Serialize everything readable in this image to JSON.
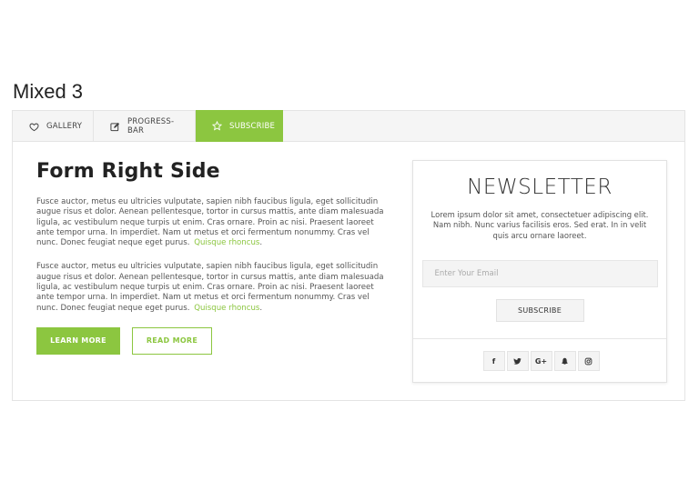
{
  "page": {
    "title": "Mixed 3"
  },
  "tabs": [
    {
      "label": "GALLERY",
      "icon": "heart-icon"
    },
    {
      "label": "PROGRESS-BAR",
      "icon": "edit-icon"
    },
    {
      "label": "SUBSCRIBE",
      "icon": "star-icon",
      "active": true
    }
  ],
  "content": {
    "heading": "Form Right Side",
    "paragraphs": [
      {
        "text": "Fusce auctor, metus eu ultricies vulputate, sapien nibh faucibus ligula, eget sollicitudin augue risus et dolor. Aenean pellentesque, tortor in cursus mattis, ante diam malesuada ligula, ac vestibulum neque turpis ut enim. Cras ornare. Proin ac nisi. Praesent laoreet ante tempor urna. In imperdiet. Nam ut metus et orci fermentum nonummy. Cras vel nunc. Donec feugiat neque eget purus.",
        "link": "Quisque rhoncus",
        "suffix": "."
      },
      {
        "text": "Fusce auctor, metus eu ultricies vulputate, sapien nibh faucibus ligula, eget sollicitudin augue risus et dolor. Aenean pellentesque, tortor in cursus mattis, ante diam malesuada ligula, ac vestibulum neque turpis ut enim. Cras ornare. Proin ac nisi. Praesent laoreet ante tempor urna. In imperdiet. Nam ut metus et orci fermentum nonummy. Cras vel nunc. Donec feugiat neque eget purus.",
        "link": "Quisque rhoncus",
        "suffix": "."
      }
    ],
    "buttons": {
      "learn_more": "LEARN MORE",
      "read_more": "READ MORE"
    }
  },
  "newsletter": {
    "title": "NEWSLETTER",
    "description": "Lorem ipsum dolor sit amet, consectetuer adipiscing elit. Nam nibh. Nunc varius facilisis eros. Sed erat. In in velit quis arcu ornare laoreet.",
    "email_placeholder": "Enter Your Email",
    "submit_label": "SUBSCRIBE",
    "social": [
      {
        "icon": "facebook-icon",
        "glyph": "f"
      },
      {
        "icon": "twitter-icon",
        "glyph": "🐦"
      },
      {
        "icon": "google-plus-icon",
        "glyph": "G+"
      },
      {
        "icon": "snapchat-icon",
        "glyph": "👻"
      },
      {
        "icon": "instagram-icon",
        "glyph": "◎"
      }
    ]
  },
  "colors": {
    "accent": "#8cc640",
    "tab_bar": "#f5f5f5",
    "border": "#e4e4e4"
  }
}
